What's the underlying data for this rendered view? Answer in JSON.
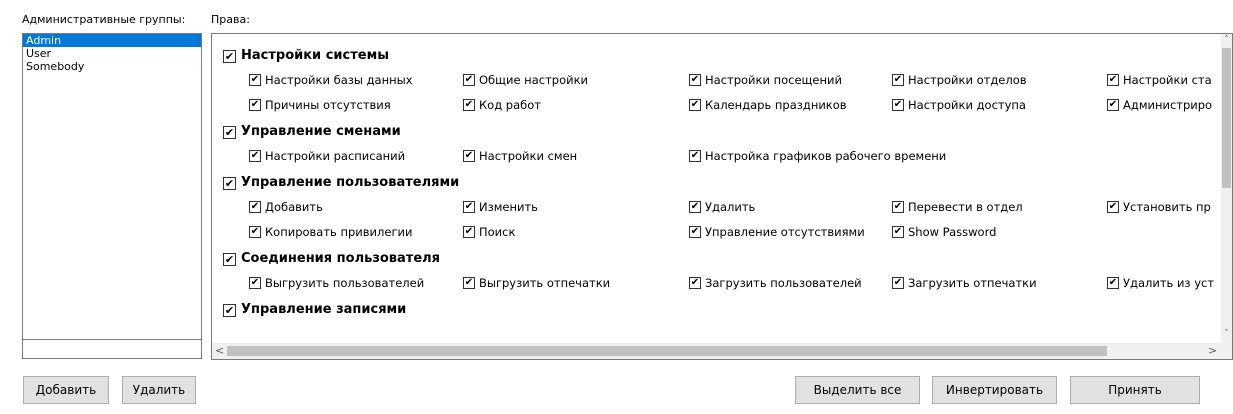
{
  "labels": {
    "groups": "Административные группы:",
    "rights": "Права:"
  },
  "groups": [
    "Admin",
    "User",
    "Somebody"
  ],
  "selected_group": "Admin",
  "group_name_input": {
    "value": ""
  },
  "sections": [
    {
      "title": "Настройки системы",
      "checked": true,
      "rows": [
        [
          "Настройки базы данных",
          "Общие настройки",
          "Настройки посещений",
          "Настройки отделов",
          "Настройки ста"
        ],
        [
          "Причины отсутствия",
          "Код работ",
          "Календарь праздников",
          "Настройки доступа",
          "Администриро"
        ]
      ]
    },
    {
      "title": "Управление сменами",
      "checked": true,
      "rows": [
        [
          "Настройки расписаний",
          "Настройки смен",
          "Настройка графиков рабочего времени"
        ]
      ]
    },
    {
      "title": "Управление пользователями",
      "checked": true,
      "rows": [
        [
          "Добавить",
          "Изменить",
          "Удалить",
          "Перевести в отдел",
          "Установить пр"
        ],
        [
          "Копировать привилегии",
          "Поиск",
          "Управление отсутствиями",
          "Show Password"
        ]
      ]
    },
    {
      "title": "Соединения пользователя",
      "checked": true,
      "rows": [
        [
          "Выгрузить пользователей",
          "Выгрузить отпечатки",
          "Загрузить пользователей",
          "Загрузить отпечатки",
          "Удалить из уст"
        ]
      ]
    },
    {
      "title": "Управление записями",
      "checked": true,
      "rows": []
    }
  ],
  "checkmark": "✔",
  "buttons": {
    "add": "Добавить",
    "delete": "Удалить",
    "select_all": "Выделить все",
    "invert": "Инвертировать",
    "apply": "Принять"
  },
  "scroll_arrows": {
    "up": "˄",
    "down": "˅",
    "left": "<",
    "right": ">"
  }
}
